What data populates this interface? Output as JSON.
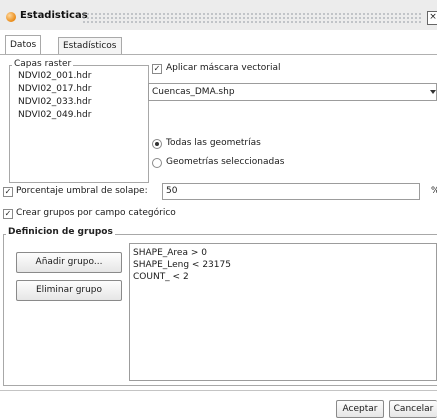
{
  "window": {
    "title": "Estadisticas",
    "close_glyph": "×"
  },
  "tabs": [
    {
      "label": "Datos"
    },
    {
      "label": "Estadísticos"
    }
  ],
  "raster_group": {
    "legend": "Capas raster",
    "layers": [
      "NDVI02_001.hdr",
      "NDVI02_017.hdr",
      "NDVI02_033.hdr",
      "NDVI02_049.hdr"
    ]
  },
  "vector_mask": {
    "checkbox_label": "Aplicar máscara vectorial",
    "checked": true,
    "layer_value": "Cuencas_DMA.shp",
    "dropdown_icon": "caret-down-icon",
    "radio_all": "Todas las geometrías",
    "radio_selected": "Geometrías seleccionadas",
    "selected_option": "all"
  },
  "overlap": {
    "label": "Porcentaje umbral de solape:",
    "value": "50",
    "checked": true,
    "trailing": "%"
  },
  "categorical": {
    "label": "Crear grupos por campo categórico",
    "checked": true
  },
  "groups": {
    "legend": "Definicion de grupos",
    "add_button": "Añadir grupo...",
    "remove_button": "Eliminar grupo",
    "definitions": [
      "SHAPE_Area > 0",
      "SHAPE_Leng < 23175",
      "COUNT_ < 2"
    ]
  },
  "footer": {
    "accept": "Aceptar",
    "cancel": "Cancelar"
  },
  "colors": {
    "accent_icon": "#e98a17"
  }
}
